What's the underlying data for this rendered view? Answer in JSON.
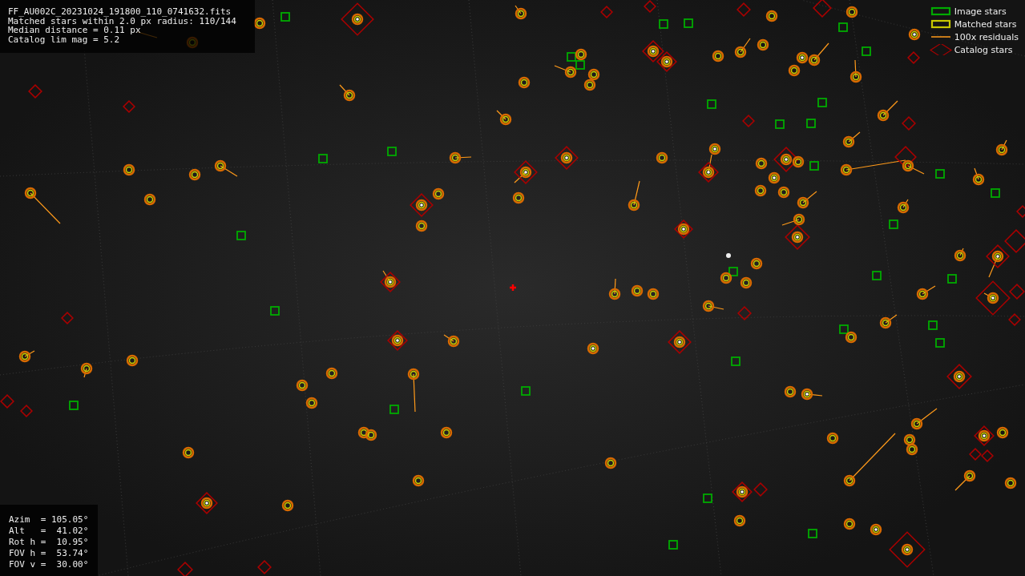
{
  "info_lines": [
    "FF_AU002C_20231024_191800_110_0741632.fits",
    "Matched stars within 2.0 px radius: 110/144",
    "Median distance = 0.11 px",
    "Catalog lim mag = 5.2"
  ],
  "legend": [
    {
      "kind": "image",
      "label": "Image stars"
    },
    {
      "kind": "matched",
      "label": "Matched stars"
    },
    {
      "kind": "residual",
      "label": "100x residuals"
    },
    {
      "kind": "catalog",
      "label": "Catalog stars"
    }
  ],
  "pointing_lines": [
    "Azim  = 105.05°",
    "Alt   =  41.02°",
    "Rot h =  10.95°",
    "FOV h =  53.74°",
    "FOV v =  30.00°"
  ]
}
